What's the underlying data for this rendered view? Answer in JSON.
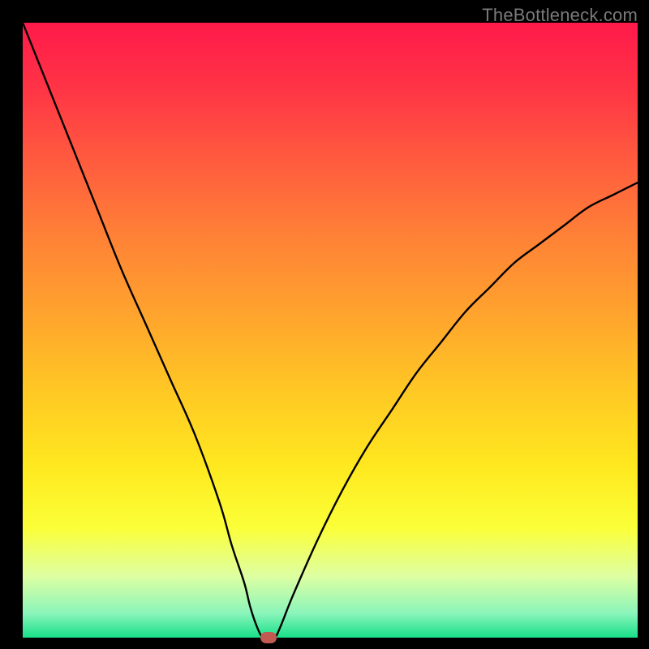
{
  "watermark": "TheBottleneck.com",
  "chart_data": {
    "type": "line",
    "title": "",
    "xlabel": "",
    "ylabel": "",
    "xlim": [
      0,
      100
    ],
    "ylim": [
      0,
      100
    ],
    "grid": false,
    "background": {
      "type": "vertical-gradient",
      "stops": [
        {
          "offset": 0.0,
          "color": "#ff1a4a"
        },
        {
          "offset": 0.1,
          "color": "#ff3246"
        },
        {
          "offset": 0.22,
          "color": "#ff5a3f"
        },
        {
          "offset": 0.35,
          "color": "#ff8236"
        },
        {
          "offset": 0.48,
          "color": "#ffa52d"
        },
        {
          "offset": 0.6,
          "color": "#ffc824"
        },
        {
          "offset": 0.72,
          "color": "#ffe81f"
        },
        {
          "offset": 0.82,
          "color": "#fbff37"
        },
        {
          "offset": 0.9,
          "color": "#deffa2"
        },
        {
          "offset": 0.96,
          "color": "#8cf5bb"
        },
        {
          "offset": 1.0,
          "color": "#18e08a"
        }
      ]
    },
    "series": [
      {
        "name": "bottleneck-curve",
        "color": "#000000",
        "stroke_width": 2.4,
        "x": [
          0,
          4,
          8,
          12,
          16,
          20,
          24,
          28,
          32,
          34,
          36,
          37,
          38,
          39,
          40,
          41,
          42,
          44,
          48,
          52,
          56,
          60,
          64,
          68,
          72,
          76,
          80,
          84,
          88,
          92,
          96,
          100
        ],
        "y": [
          100,
          90,
          80,
          70,
          60,
          51,
          42,
          33,
          22,
          15,
          9,
          5,
          2,
          0,
          0,
          0,
          2,
          7,
          16,
          24,
          31,
          37,
          43,
          48,
          53,
          57,
          61,
          64,
          67,
          70,
          72,
          74
        ]
      }
    ],
    "marker": {
      "x": 40,
      "y": 0,
      "color": "#c15a52"
    }
  }
}
